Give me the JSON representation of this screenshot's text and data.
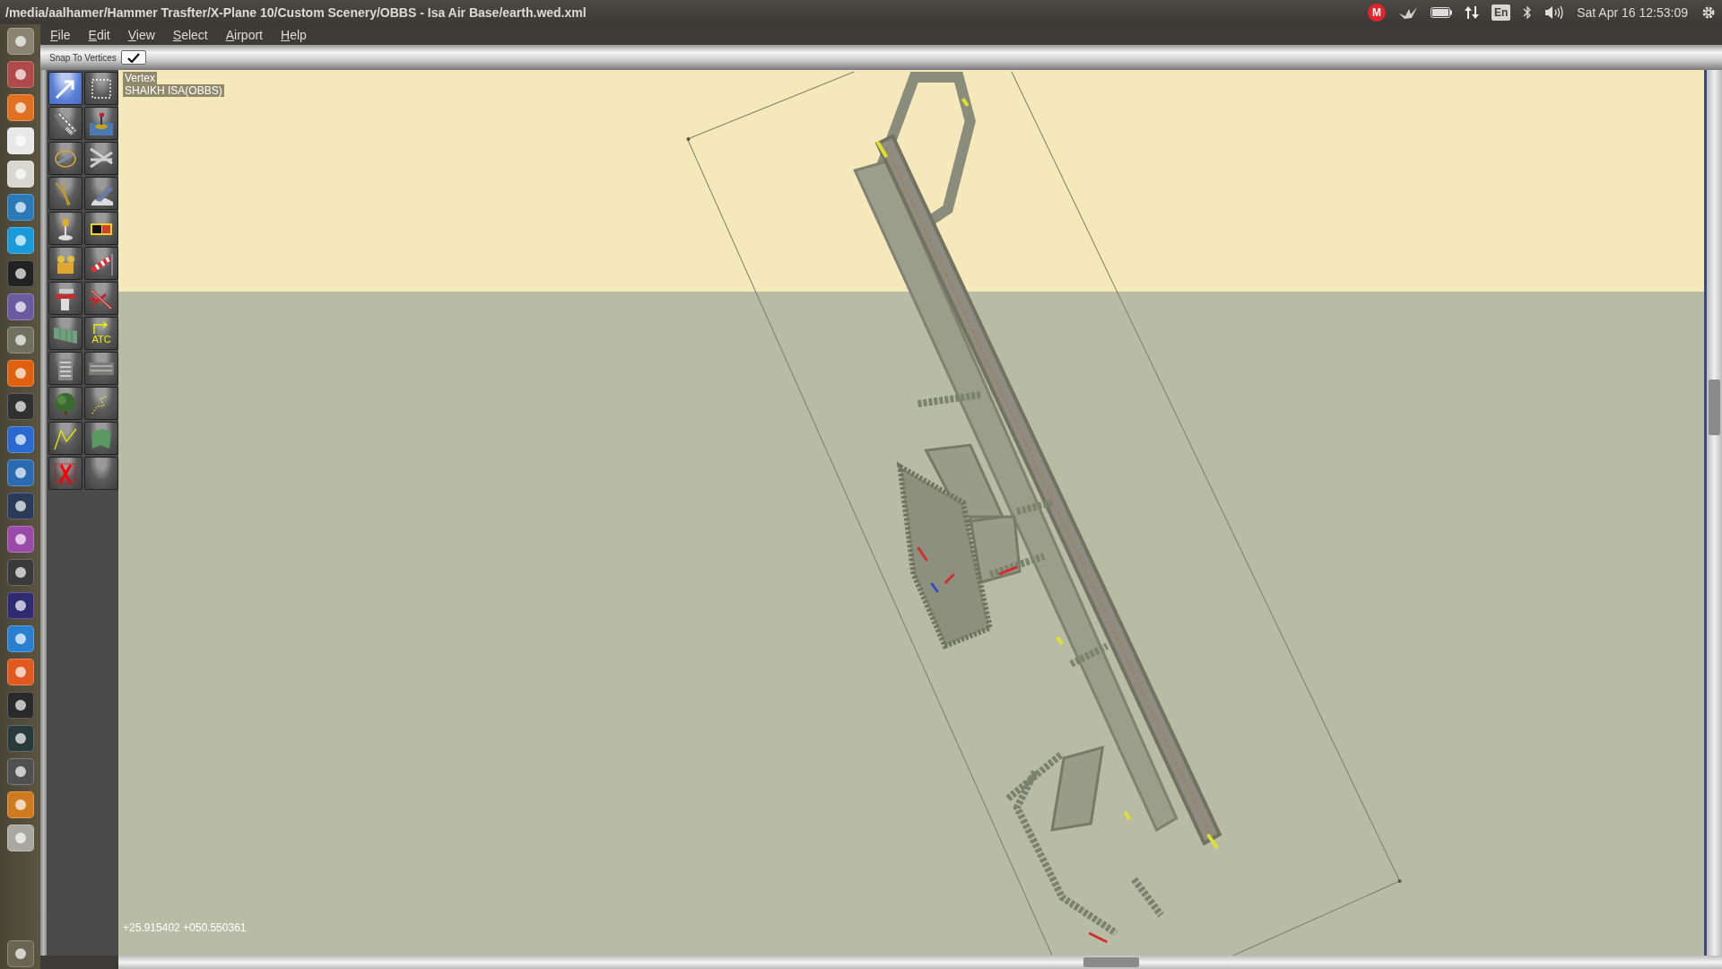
{
  "window": {
    "title": "/media/aalhamer/Hammer Trasfter/X-Plane 10/Custom Scenery/OBBS - Isa Air Base/earth.wed.xml"
  },
  "tray": {
    "mail_badge": "M",
    "keyboard": "En",
    "clock": "Sat Apr 16 12:53:09"
  },
  "menu": [
    "File",
    "Edit",
    "View",
    "Select",
    "Airport",
    "Help"
  ],
  "toolbar": {
    "snap_to_vertices": {
      "label": "Snap To Vertices",
      "checked": true
    }
  },
  "tools": [
    {
      "selected": true
    },
    {
      "selected": false
    },
    {
      "selected": false
    },
    {
      "selected": false
    },
    {
      "selected": false
    },
    {
      "selected": false
    },
    {
      "selected": false
    },
    {
      "selected": false
    },
    {
      "selected": false
    },
    {
      "selected": false
    },
    {
      "selected": false
    },
    {
      "selected": false
    },
    {
      "selected": false
    },
    {
      "selected": false
    },
    {
      "selected": false
    },
    {
      "selected": false,
      "label": "ATC"
    },
    {
      "selected": false
    },
    {
      "selected": false
    },
    {
      "selected": false
    },
    {
      "selected": false
    },
    {
      "selected": false
    },
    {
      "selected": false
    },
    {
      "selected": false
    },
    {
      "selected": false
    }
  ],
  "map": {
    "tool_name": "Vertex",
    "airport": "SHAIKH ISA(OBBS)",
    "coordinates": "+25.915402 +050.550361"
  }
}
